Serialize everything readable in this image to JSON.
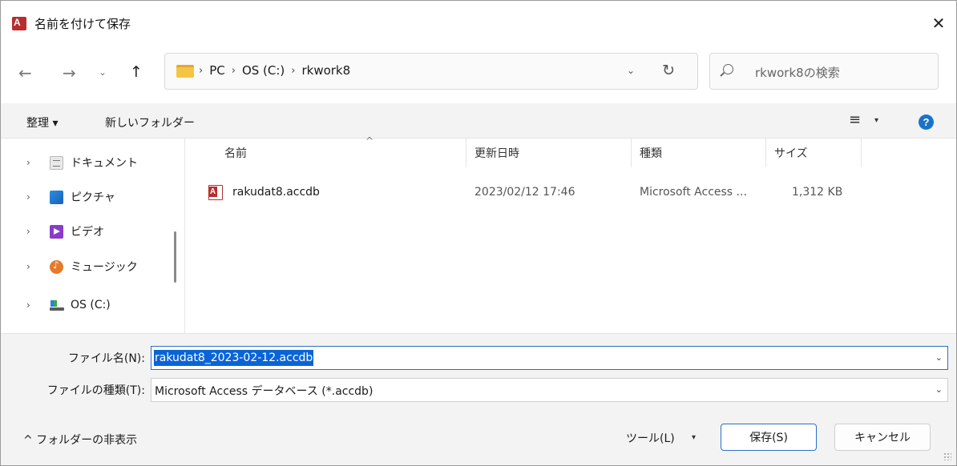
{
  "window": {
    "title": "名前を付けて保存",
    "close_glyph": "✕"
  },
  "nav": {
    "back_glyph": "←",
    "forward_glyph": "→",
    "recent_glyph": "⌄",
    "up_glyph": "↑",
    "breadcrumbs": [
      "PC",
      "OS (C:)",
      "rkwork8"
    ],
    "crumb_separator": "›",
    "address_dropdown_glyph": "⌄",
    "refresh_glyph": "↻",
    "search_placeholder": "rkwork8の検索"
  },
  "commandbar": {
    "organize_label": "整理 ▾",
    "new_folder_label": "新しいフォルダー",
    "view_glyph": "≡",
    "view_arrow": "▾",
    "help_glyph": "?"
  },
  "sidebar": {
    "items": [
      {
        "label": "ドキュメント",
        "icon": "documents-icon"
      },
      {
        "label": "ピクチャ",
        "icon": "pictures-icon"
      },
      {
        "label": "ビデオ",
        "icon": "videos-icon"
      },
      {
        "label": "ミュージック",
        "icon": "music-icon"
      },
      {
        "label": "OS (C:)",
        "icon": "drive-icon"
      }
    ],
    "chevron": "›"
  },
  "filelist": {
    "columns": {
      "name": "名前",
      "modified": "更新日時",
      "type": "種類",
      "size": "サイズ"
    },
    "sort_glyph": "^",
    "rows": [
      {
        "name": "rakudat8.accdb",
        "modified": "2023/02/12 17:46",
        "type": "Microsoft Access ...",
        "size": "1,312 KB"
      }
    ]
  },
  "save_form": {
    "filename_label": "ファイル名(N):",
    "filename_value": "rakudat8_2023-02-12.accdb",
    "filetype_label": "ファイルの種類(T):",
    "filetype_value": "Microsoft Access データベース (*.accdb)",
    "dropdown_glyph": "⌄"
  },
  "footer": {
    "hide_folders_label": "^ フォルダーの非表示",
    "tools_label": "ツール(L)",
    "tools_arrow": "▾",
    "save_label": "保存(S)",
    "cancel_label": "キャンセル"
  },
  "colors": {
    "accent": "#0a64d6",
    "access_red": "#b72e2e",
    "folder_yellow": "#f4c545",
    "help_blue": "#1a73c8"
  }
}
